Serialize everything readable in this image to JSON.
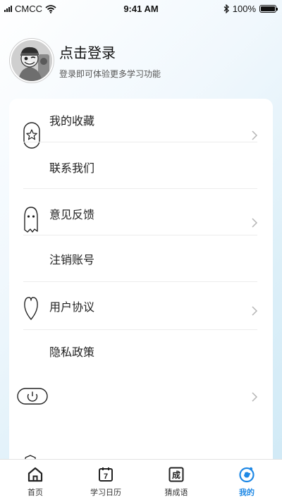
{
  "status_bar": {
    "carrier": "CMCC",
    "time": "9:41 AM",
    "battery": "100%",
    "battery_level": 1.0
  },
  "profile": {
    "title": "点击登录",
    "subtitle": "登录即可体验更多学习功能"
  },
  "menu": {
    "items": [
      {
        "label": "我的收藏"
      },
      {
        "label": "联系我们"
      },
      {
        "label": "意见反馈"
      },
      {
        "label": "注销账号"
      },
      {
        "label": "用户协议"
      },
      {
        "label": "隐私政策"
      }
    ]
  },
  "tabs": [
    {
      "label": "首页",
      "icon": "home-icon"
    },
    {
      "label": "学习日历",
      "icon": "calendar-icon",
      "glyph": "7"
    },
    {
      "label": "猜成语",
      "icon": "idiom-icon",
      "glyph": "成"
    },
    {
      "label": "我的",
      "icon": "profile-face-icon"
    }
  ],
  "colors": {
    "accent": "#1e88e5",
    "card": "#ffffff",
    "background": "#dceff8"
  }
}
